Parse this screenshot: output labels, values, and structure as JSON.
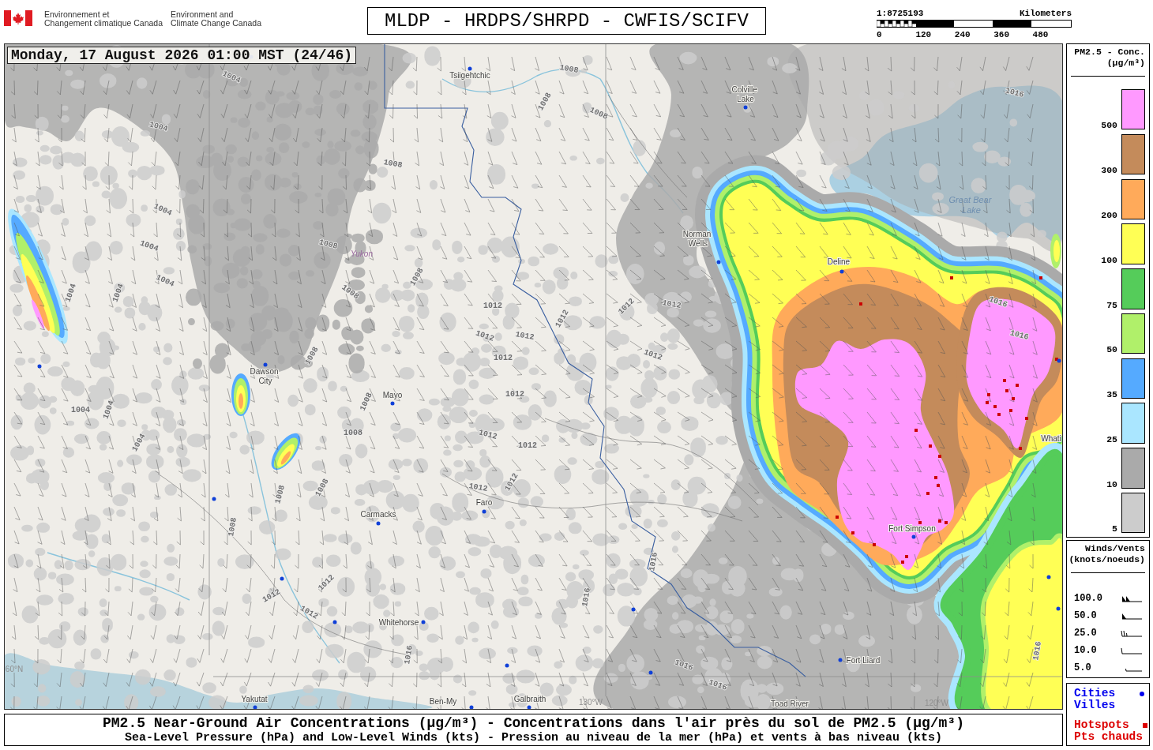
{
  "header": {
    "agency_fr": [
      "Environnement et",
      "Changement climatique Canada"
    ],
    "agency_en": [
      "Environment and",
      "Climate Change Canada"
    ],
    "title": "MLDP - HRDPS/SHRPD - CWFIS/SCIFV",
    "scale": {
      "ratio": "1:8725193",
      "unit": "Kilometers",
      "ticks": [
        "0",
        "120",
        "240",
        "360",
        "480"
      ]
    }
  },
  "map": {
    "timestamp": "Monday, 17 August 2026 01:00 MST (24/46)",
    "places": [
      {
        "kind": "city",
        "lines": [
          "Tsiigehtchic"
        ]
      },
      {
        "kind": "city",
        "lines": [
          "Colville",
          "Lake"
        ]
      },
      {
        "kind": "lake",
        "lines": [
          "Great Bear",
          "Lake"
        ]
      },
      {
        "kind": "city",
        "lines": [
          "Norman",
          "Wells"
        ]
      },
      {
        "kind": "region",
        "lines": [
          "Yukon"
        ]
      },
      {
        "kind": "city",
        "lines": [
          "Deline"
        ]
      },
      {
        "kind": "city",
        "lines": [
          "Dawson",
          "City"
        ]
      },
      {
        "kind": "city",
        "lines": [
          "Mayo"
        ]
      },
      {
        "kind": "city",
        "lines": [
          "Whati"
        ]
      },
      {
        "kind": "city",
        "lines": [
          "Faro"
        ]
      },
      {
        "kind": "city",
        "lines": [
          "Carmacks"
        ]
      },
      {
        "kind": "city",
        "lines": [
          "Fort Simpson"
        ]
      },
      {
        "kind": "city",
        "lines": [
          "Whitehorse"
        ]
      },
      {
        "kind": "city",
        "lines": [
          "Fort Liard"
        ]
      },
      {
        "kind": "graticule",
        "lines": [
          "60°N"
        ]
      },
      {
        "kind": "city",
        "lines": [
          "Yakutat"
        ]
      },
      {
        "kind": "city",
        "lines": [
          "Ben-My"
        ]
      },
      {
        "kind": "city",
        "lines": [
          "Galbraith"
        ]
      },
      {
        "kind": "graticule",
        "lines": [
          "130°W"
        ]
      },
      {
        "kind": "city",
        "lines": [
          "Toad River"
        ]
      },
      {
        "kind": "graticule",
        "lines": [
          "120°W"
        ]
      }
    ],
    "isobar_labels": [
      "1004",
      "1004",
      "1004",
      "1004",
      "1004",
      "1004",
      "1004",
      "1004",
      "1004",
      "1004",
      "1008",
      "1008",
      "1008",
      "1008",
      "1008",
      "1008",
      "1008",
      "1008",
      "1008",
      "1008",
      "1008",
      "1008",
      "1008",
      "1012",
      "1012",
      "1012",
      "1012",
      "1012",
      "1012",
      "1012",
      "1012",
      "1012",
      "1012",
      "1012",
      "1012",
      "1012",
      "1012",
      "1012",
      "1012",
      "1016",
      "1016",
      "1016",
      "1016",
      "1016",
      "1016",
      "1016",
      "1016",
      "1016"
    ]
  },
  "legend": {
    "title": "PM2.5 - Conc.",
    "unit": "(µg/m³)",
    "bins": [
      {
        "label": "500",
        "color": "#ff99ff"
      },
      {
        "label": "300",
        "color": "#c48b5b"
      },
      {
        "label": "200",
        "color": "#ffaa5a"
      },
      {
        "label": "100",
        "color": "#ffff55"
      },
      {
        "label": "75",
        "color": "#55cc5a"
      },
      {
        "label": "50",
        "color": "#b0f06a"
      },
      {
        "label": "35",
        "color": "#55aaff"
      },
      {
        "label": "25",
        "color": "#aae6ff"
      },
      {
        "label": "10",
        "color": "#aaaaaa"
      },
      {
        "label": "5",
        "color": "#cccccc"
      }
    ]
  },
  "winds": {
    "title": "Winds/Vents",
    "unit": "(knots/noeuds)",
    "speeds": [
      "100.0",
      "50.0",
      "25.0",
      "10.0",
      "5.0"
    ]
  },
  "map_key": [
    {
      "kind": "city",
      "lines": [
        "Cities",
        "Villes"
      ]
    },
    {
      "kind": "hotspot",
      "lines": [
        "Hotspots",
        "Pts chauds"
      ]
    }
  ],
  "footer": {
    "title": "PM2.5 Near-Ground Air Concentrations (µg/m³) - Concentrations dans l'air près du sol de PM2.5 (µg/m³)",
    "subtitle": "Sea-Level Pressure (hPa) and Low-Level Winds (kts) - Pression au niveau de la mer (hPa) et vents à bas niveau (kts)"
  }
}
